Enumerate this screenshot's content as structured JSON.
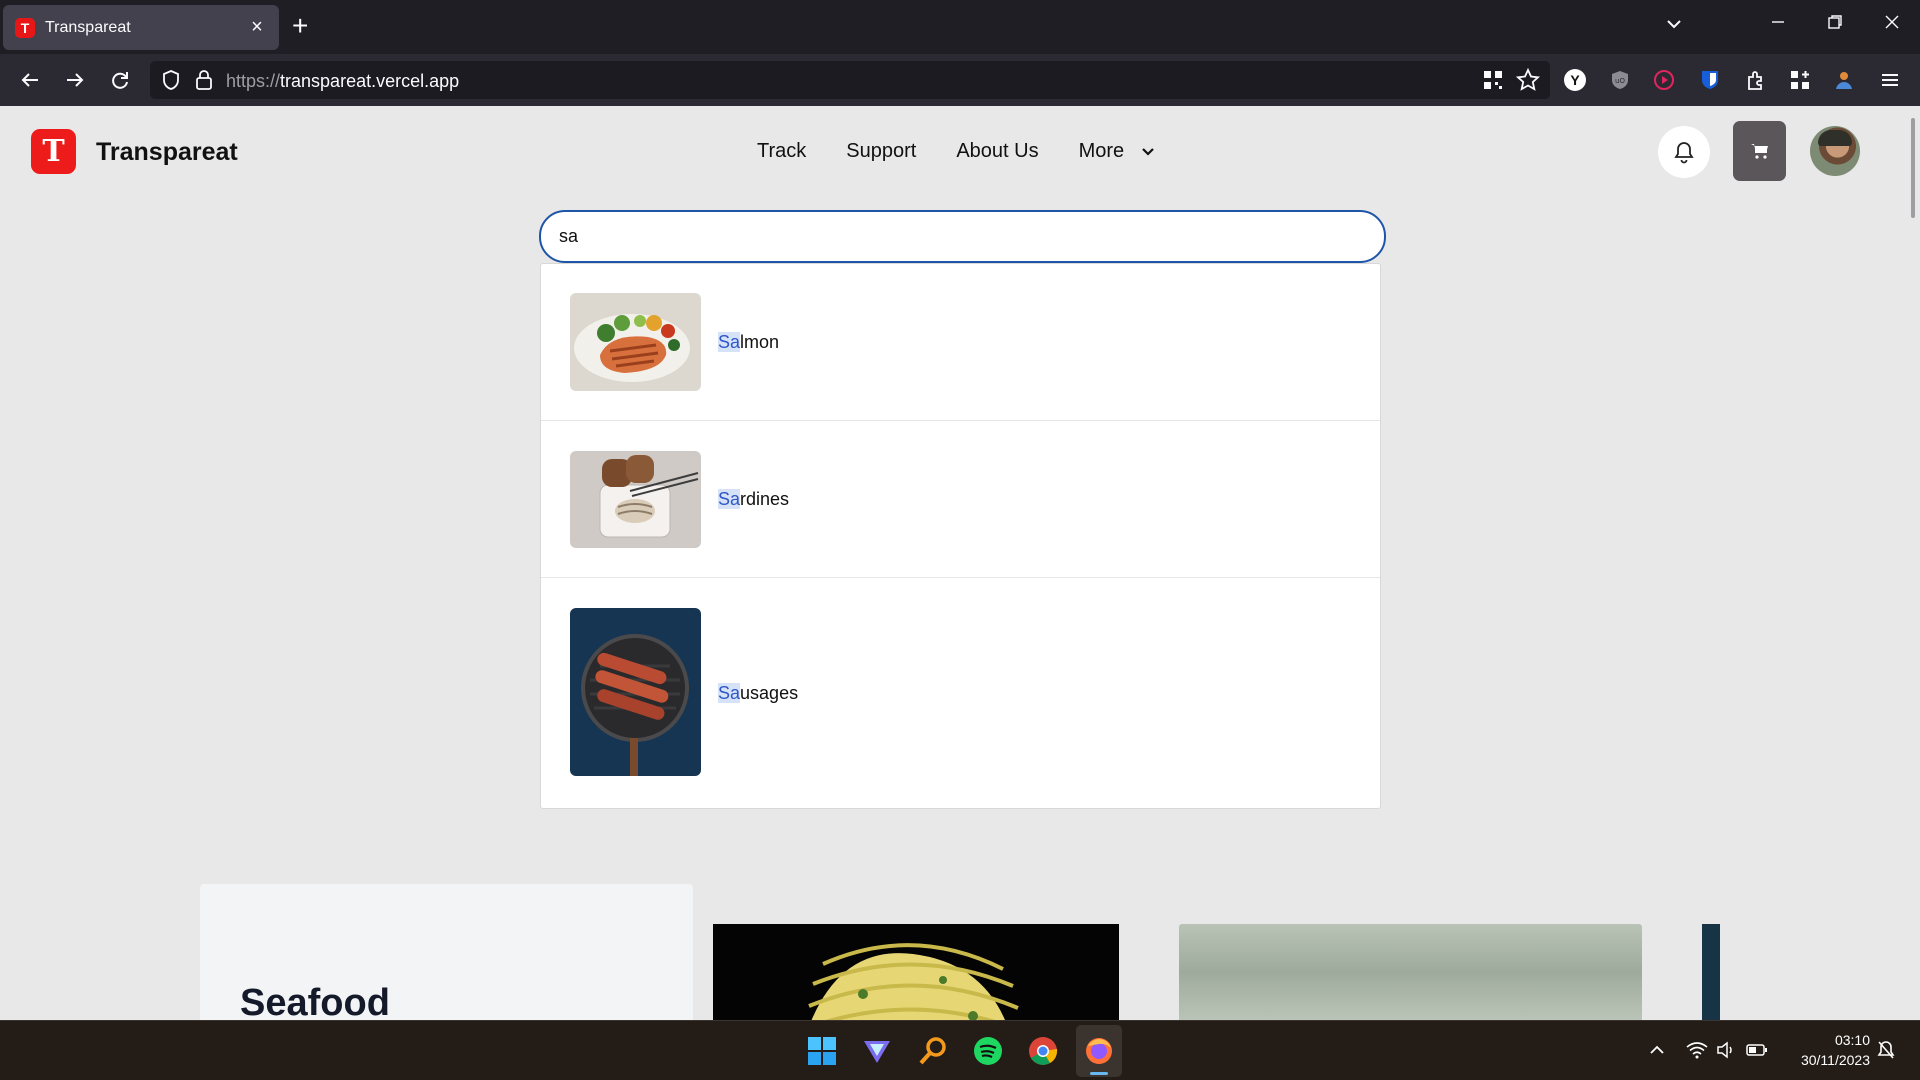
{
  "browser": {
    "tab_title": "Transpareat",
    "url_protocol": "https://",
    "url_host": "transpareat.vercel.app"
  },
  "site": {
    "logo_letter": "T",
    "brand": "Transpareat",
    "nav": [
      "Track",
      "Support",
      "About Us",
      "More"
    ],
    "accent_color": "#ee1b1b"
  },
  "search": {
    "query": "sa",
    "results": [
      {
        "match": "Sa",
        "rest": "lmon",
        "image": "grilled-salmon-salad"
      },
      {
        "match": "Sa",
        "rest": "rdines",
        "image": "sardines-with-bread"
      },
      {
        "match": "Sa",
        "rest": "usages",
        "image": "sausages-in-pan"
      }
    ]
  },
  "category": {
    "title": "Seafood"
  },
  "taskbar": {
    "time": "03:10",
    "date": "30/11/2023"
  }
}
